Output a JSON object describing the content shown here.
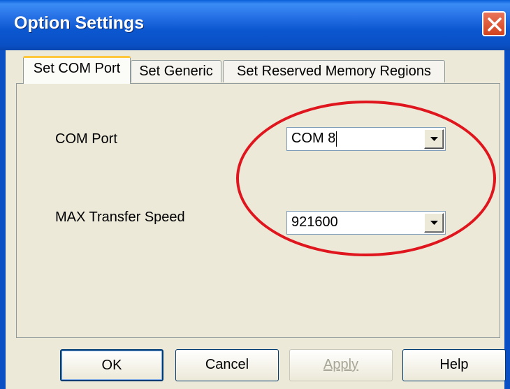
{
  "window": {
    "title": "Option Settings",
    "close_icon": "close-icon"
  },
  "tabs": [
    {
      "label": "Set COM Port",
      "active": true
    },
    {
      "label": "Set Generic",
      "active": false
    },
    {
      "label": "Set Reserved Memory Regions",
      "active": false
    }
  ],
  "fields": {
    "com_port": {
      "label": "COM Port",
      "value": "COM 8"
    },
    "max_speed": {
      "label": "MAX Transfer Speed",
      "value": "921600"
    }
  },
  "annotation": {
    "color": "#e0161e",
    "shape": "ellipse"
  },
  "buttons": {
    "ok": "OK",
    "cancel": "Cancel",
    "apply": "Apply",
    "help": "Help"
  },
  "colors": {
    "titlebar": "#0a56cc",
    "dialog_bg": "#ece9d8",
    "close_button": "#d2431e"
  }
}
